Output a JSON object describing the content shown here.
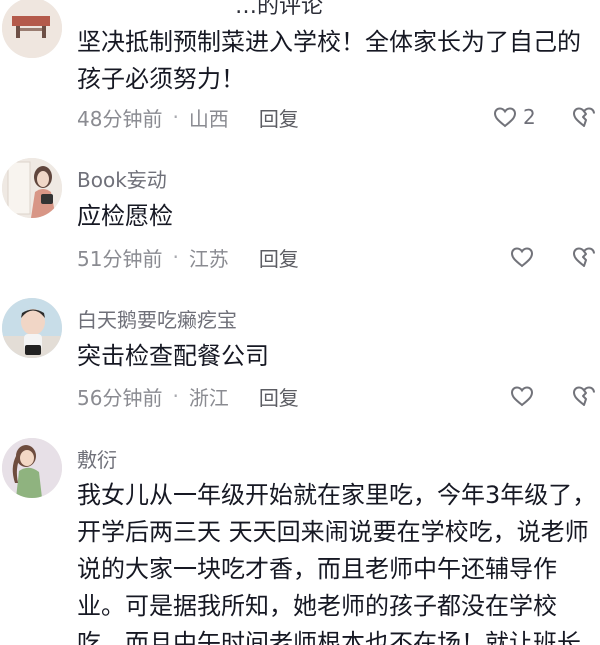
{
  "header_partial": "…的评论",
  "comments": [
    {
      "username": "",
      "text": "坚决抵制预制菜进入学校！全体家长为了自己的孩子必须努力！",
      "time": "48分钟前",
      "location": "山西",
      "reply_label": "回复",
      "likes": "2",
      "avatar_icon": "avatar-image"
    },
    {
      "username": "Book妄动",
      "text": "应检愿检",
      "time": "51分钟前",
      "location": "江苏",
      "reply_label": "回复",
      "likes": "",
      "avatar_icon": "avatar-image"
    },
    {
      "username": "白天鹅要吃癞疙宝",
      "text": "突击检查配餐公司",
      "time": "56分钟前",
      "location": "浙江",
      "reply_label": "回复",
      "likes": "",
      "avatar_icon": "avatar-image"
    },
    {
      "username": "敷衍",
      "text": "我女儿从一年级开始就在家里吃，今年3年级了，开学后两三天 天天回来闹说要在学校吃，说老师说的大家一块吃才香，而且老师中午还辅导作业。可是据我所知，她老师的孩子都没在学校吃，而且中午时间老师根本也不在场！就让班长",
      "time": "",
      "location": "",
      "reply_label": "",
      "likes": "",
      "avatar_icon": "avatar-image"
    }
  ],
  "colors": {
    "text": "#161823",
    "secondary": "#8a8b91",
    "reply": "#5c5d63"
  }
}
